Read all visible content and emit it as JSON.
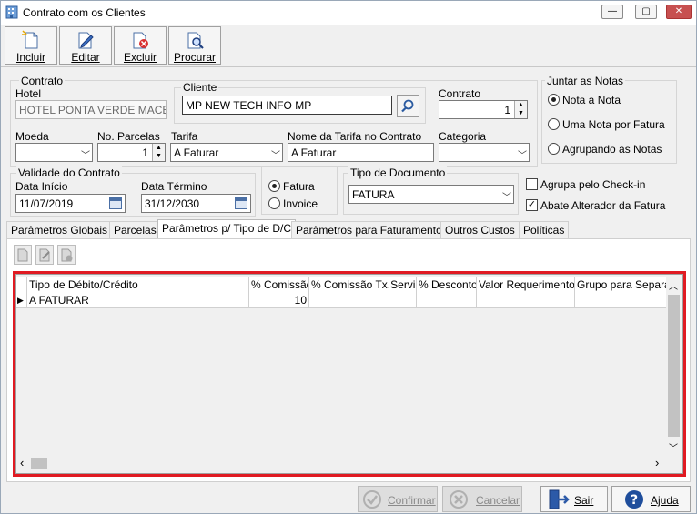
{
  "window": {
    "title": "Contrato com os Clientes",
    "min": "—",
    "max": "▢",
    "close": "✕"
  },
  "toolbar": {
    "incluir": "Incluir",
    "editar": "Editar",
    "excluir": "Excluir",
    "procurar": "Procurar"
  },
  "contrato_group": {
    "title": "Contrato",
    "hotel_label": "Hotel",
    "hotel_value": "HOTEL PONTA VERDE MACEIÓ",
    "cliente_title": "Cliente",
    "cliente_value": "MP NEW TECH INFO MP",
    "contrato_label": "Contrato",
    "contrato_value": "1",
    "moeda_label": "Moeda",
    "moeda_value": "",
    "parcelas_label": "No. Parcelas",
    "parcelas_value": "1",
    "tarifa_label": "Tarifa",
    "tarifa_value": "A Faturar",
    "nome_tarifa_label": "Nome da Tarifa no Contrato",
    "nome_tarifa_value": "A Faturar",
    "categoria_label": "Categoria",
    "categoria_value": ""
  },
  "juntar": {
    "title": "Juntar as Notas",
    "options": [
      "Nota a Nota",
      "Uma Nota por Fatura",
      "Agrupando as Notas"
    ],
    "selected": "Nota a Nota"
  },
  "validade": {
    "title": "Validade do Contrato",
    "inicio_label": "Data Início",
    "inicio_value": "11/07/2019",
    "termino_label": "Data Término",
    "termino_value": "31/12/2030"
  },
  "fatura_radio": {
    "options": [
      "Fatura",
      "Invoice"
    ],
    "selected": "Fatura"
  },
  "tipo_documento": {
    "title": "Tipo de Documento",
    "value": "FATURA"
  },
  "checks": {
    "agrupa": {
      "label": "Agrupa pelo Check-in",
      "checked": false,
      "mark": ""
    },
    "abate": {
      "label": "Abate Alterador da Fatura",
      "checked": true,
      "mark": "✓"
    }
  },
  "tabs": [
    "Parâmetros Globais",
    "Parcelas",
    "Parâmetros p/ Tipo de D/C",
    "Parâmetros para Faturamento",
    "Outros Custos",
    "Políticas"
  ],
  "active_tab": "Parâmetros p/ Tipo de D/C",
  "grid": {
    "columns": [
      "Tipo de Débito/Crédito",
      "% Comissão",
      "% Comissão Tx.Serviço",
      "% Desconto",
      "Valor Requerimento",
      "Grupo para Separa"
    ],
    "rows": [
      {
        "indicator": "▶",
        "cells": [
          "A FATURAR",
          "10",
          "",
          "",
          "",
          ""
        ]
      }
    ]
  },
  "scroll": {
    "up": "︿",
    "down": "﹀",
    "left": "‹",
    "right": "›"
  },
  "bottom": {
    "confirmar": "Confirmar",
    "cancelar": "Cancelar",
    "sair": "Sair",
    "ajuda": "Ajuda"
  }
}
